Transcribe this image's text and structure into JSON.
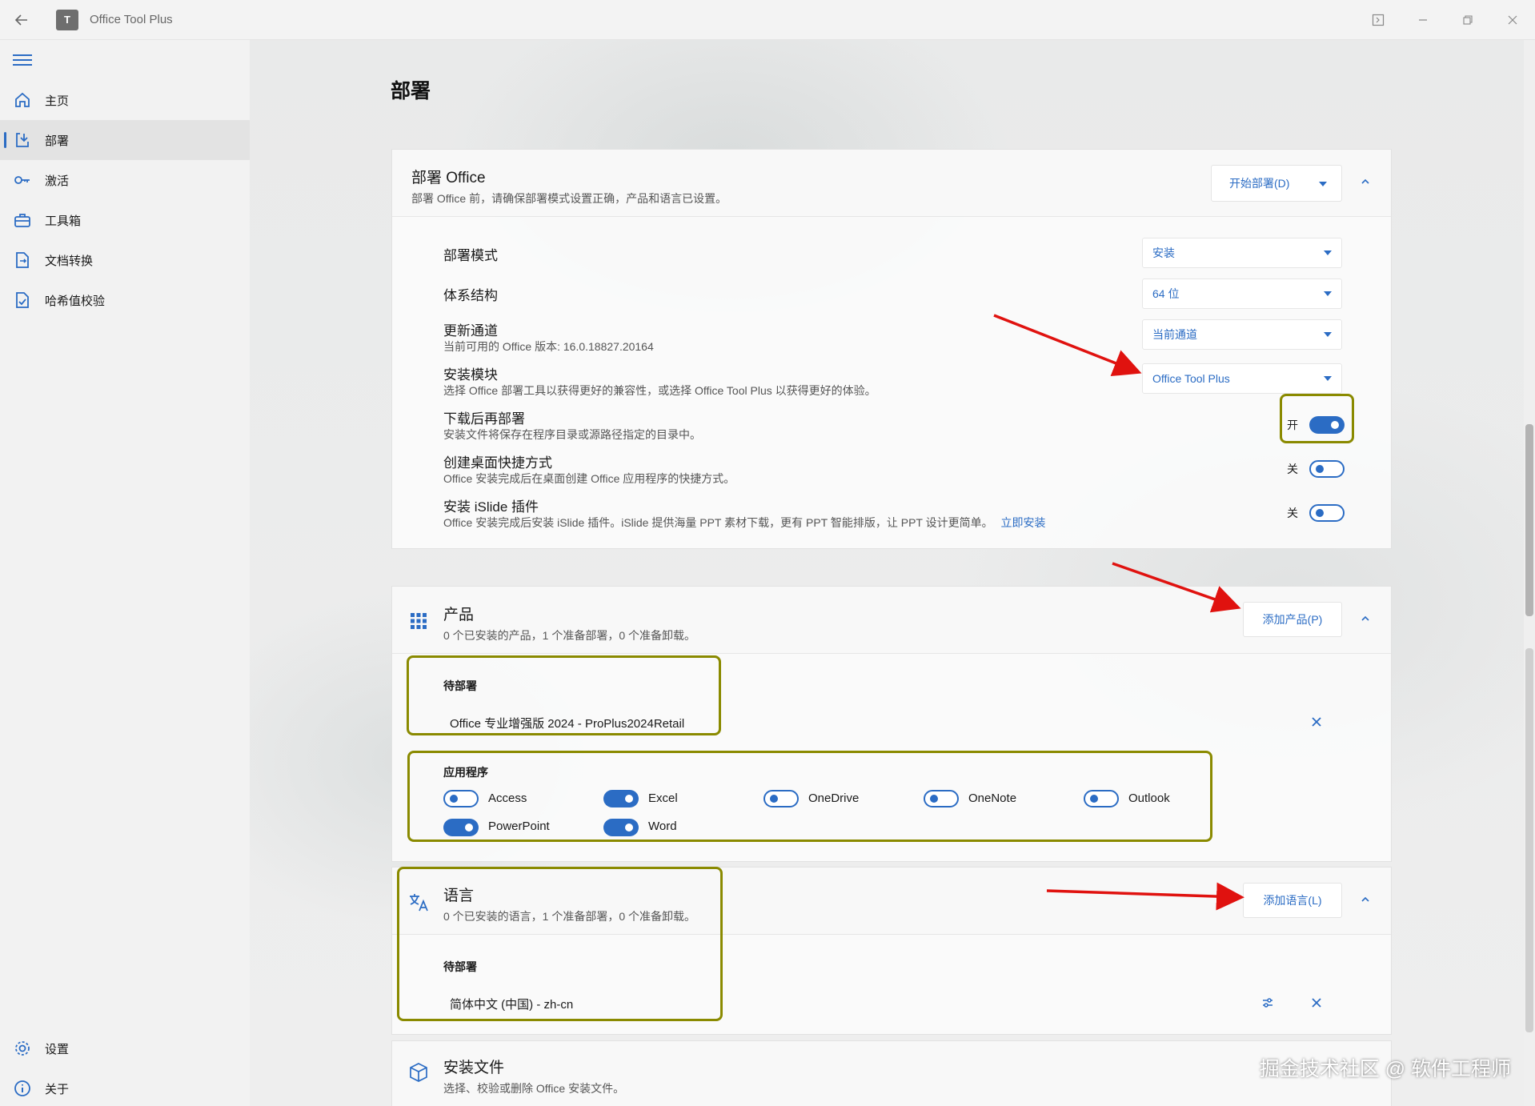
{
  "window": {
    "title": "Office Tool Plus",
    "app_icon_text": "T"
  },
  "sidebar": {
    "items": [
      {
        "label": "主页",
        "icon": "home-icon"
      },
      {
        "label": "部署",
        "icon": "deploy-icon",
        "active": true
      },
      {
        "label": "激活",
        "icon": "key-icon"
      },
      {
        "label": "工具箱",
        "icon": "toolbox-icon"
      },
      {
        "label": "文档转换",
        "icon": "doc-convert-icon"
      },
      {
        "label": "哈希值校验",
        "icon": "hash-check-icon"
      }
    ],
    "bottom": [
      {
        "label": "设置",
        "icon": "gear-icon"
      },
      {
        "label": "关于",
        "icon": "info-icon"
      }
    ]
  },
  "page": {
    "title": "部署"
  },
  "deploy_office": {
    "title": "部署 Office",
    "subtitle": "部署 Office 前，请确保部署模式设置正确，产品和语言已设置。",
    "start_button": "开始部署(D)",
    "rows": {
      "mode": {
        "label": "部署模式",
        "value": "安装"
      },
      "arch": {
        "label": "体系结构",
        "value": "64 位"
      },
      "channel": {
        "label": "更新通道",
        "sub": "当前可用的 Office 版本: 16.0.18827.20164",
        "value": "当前通道"
      },
      "module": {
        "label": "安装模块",
        "sub": "选择 Office 部署工具以获得更好的兼容性，或选择 Office Tool Plus 以获得更好的体验。",
        "value": "Office Tool Plus"
      },
      "download_first": {
        "label": "下载后再部署",
        "sub": "安装文件将保存在程序目录或源路径指定的目录中。",
        "state": "开",
        "on": true
      },
      "shortcut": {
        "label": "创建桌面快捷方式",
        "sub": "Office 安装完成后在桌面创建 Office 应用程序的快捷方式。",
        "state": "关",
        "on": false
      },
      "islide": {
        "label": "安装 iSlide 插件",
        "sub": "Office 安装完成后安装 iSlide 插件。iSlide 提供海量 PPT 素材下载，更有 PPT 智能排版，让 PPT 设计更简单。",
        "link": "立即安装",
        "state": "关",
        "on": false
      }
    }
  },
  "products": {
    "title": "产品",
    "subtitle": "0 个已安装的产品，1 个准备部署，0 个准备卸载。",
    "add_button": "添加产品(P)",
    "pending_label": "待部署",
    "pending_item": "Office 专业增强版 2024  -  ProPlus2024Retail",
    "apps_label": "应用程序",
    "apps": [
      {
        "name": "Access",
        "on": false
      },
      {
        "name": "Excel",
        "on": true
      },
      {
        "name": "OneDrive",
        "on": false
      },
      {
        "name": "OneNote",
        "on": false
      },
      {
        "name": "Outlook",
        "on": false
      },
      {
        "name": "PowerPoint",
        "on": true
      },
      {
        "name": "Word",
        "on": true
      }
    ]
  },
  "languages": {
    "title": "语言",
    "subtitle": "0 个已安装的语言，1 个准备部署，0 个准备卸载。",
    "add_button": "添加语言(L)",
    "pending_label": "待部署",
    "pending_item": "简体中文 (中国)  -  zh-cn"
  },
  "install_files": {
    "title": "安装文件",
    "subtitle": "选择、校验或删除 Office 安装文件。"
  },
  "watermark": "掘金技术社区 @ 软件工程师",
  "colors": {
    "accent": "#2b6cc4",
    "highlight_box": "#8a8a00",
    "annotation_arrow": "#e0120f"
  }
}
